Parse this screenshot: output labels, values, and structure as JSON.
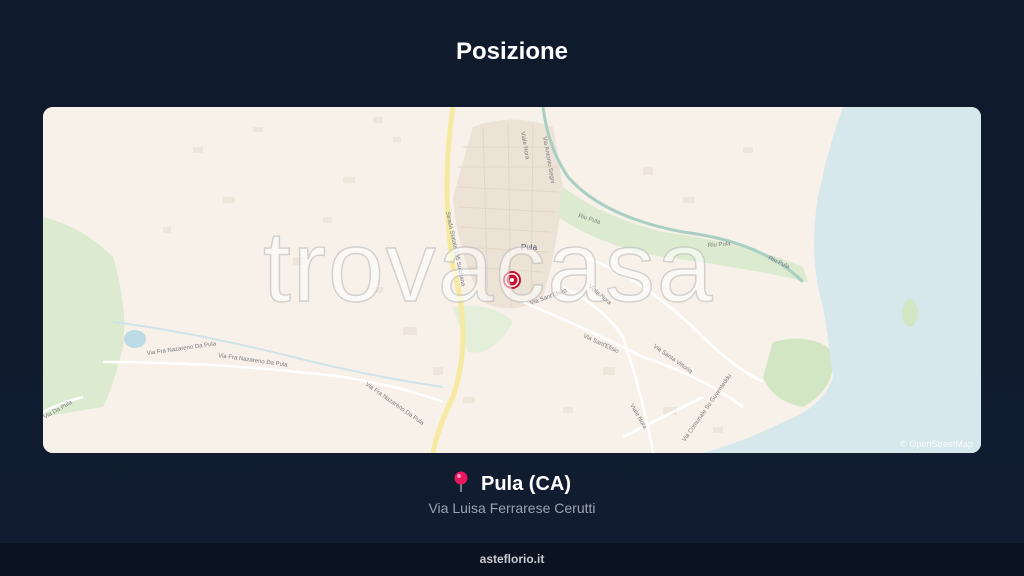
{
  "header": {
    "title": "Posizione"
  },
  "map": {
    "town_label": "Pula",
    "watermark": "trovacasa",
    "credit": "© OpenStreetMap",
    "road_labels": {
      "statale": "Strada Statale 195 Sulcitana",
      "nazareno_1": "Via Fra Nazareno Da Pula",
      "nazareno_2": "Via Fra Nazareno Da Pula",
      "nazareno_3": "Via Fra Nazareno Da Pula",
      "sant_efisio_1": "Via Sant'Efisio",
      "sant_efisio_2": "Via Sant'Efisio",
      "santa_vittoria": "Via Santa Vittoria",
      "nora_1": "Viale Nora",
      "nora_2": "Viale Nora",
      "nora_3": "Viale Nora",
      "rio_1": "Riu Pula",
      "rio_2": "Riu Pula",
      "rio_3": "Riu Pula",
      "su_guventeddu": "Via Comunale Su Guventeddu",
      "da_pula": "Via Da Pula",
      "roma": "Via Antonio Segni"
    }
  },
  "location": {
    "pin_icon": "map-pin-icon",
    "city": "Pula (CA)",
    "address": "Via Luisa Ferrarese Cerutti"
  },
  "footer": {
    "site": "asteflorio.it"
  },
  "colors": {
    "background": "#111a2c",
    "map_land": "#f7f1ea",
    "map_sea": "#d6e8ec",
    "map_green": "#dcebd0",
    "marker": "#c8102e"
  }
}
